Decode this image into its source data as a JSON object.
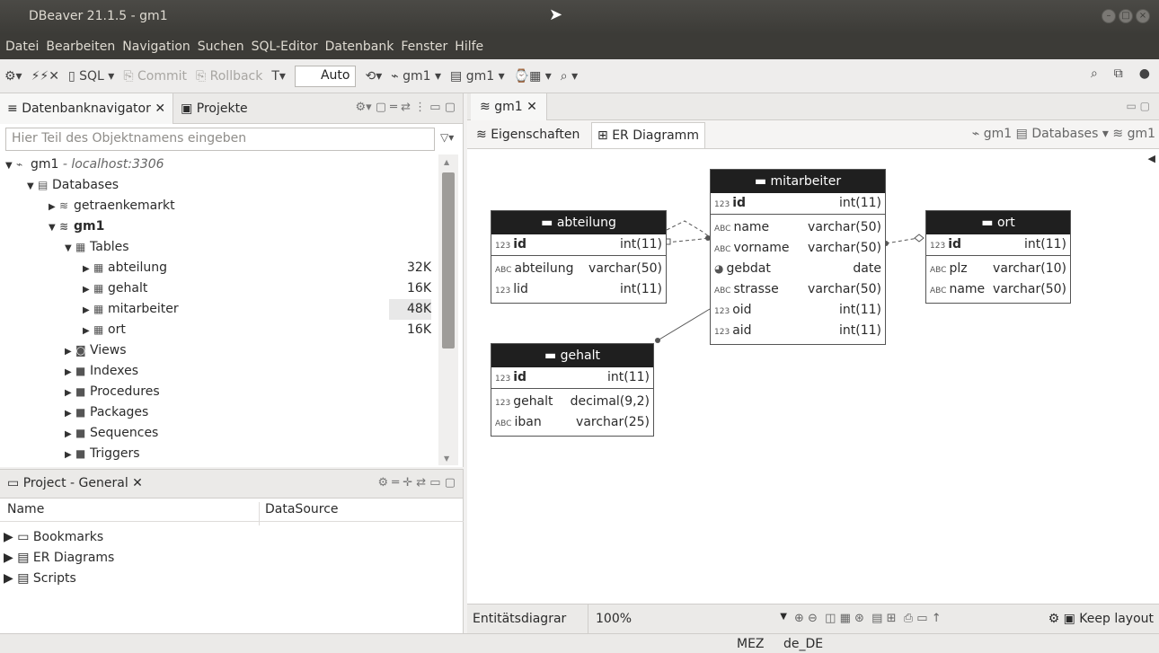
{
  "window": {
    "title": "DBeaver 21.1.5 - gm1"
  },
  "menu": [
    "Datei",
    "Bearbeiten",
    "Navigation",
    "Suchen",
    "SQL-Editor",
    "Datenbank",
    "Fenster",
    "Hilfe"
  ],
  "toolbar": {
    "sql_label": "SQL",
    "commit_label": "Commit",
    "rollback_label": "Rollback",
    "auto_label": "Auto",
    "datasource_label": "gm1",
    "schema_label": "gm1"
  },
  "navigator": {
    "tab_label": "Datenbanknavigator",
    "projects_tab_label": "Projekte",
    "filter_placeholder": "Hier Teil des Objektnamens eingeben",
    "connection": "gm1",
    "connection_host": "- localhost:3306",
    "databases_label": "Databases",
    "db1": "getraenkemarkt",
    "db2": "gm1",
    "tables_label": "Tables",
    "tables": [
      {
        "name": "abteilung",
        "size": "32K"
      },
      {
        "name": "gehalt",
        "size": "16K"
      },
      {
        "name": "mitarbeiter",
        "size": "48K"
      },
      {
        "name": "ort",
        "size": "16K"
      }
    ],
    "folders": [
      "Views",
      "Indexes",
      "Procedures",
      "Packages",
      "Sequences",
      "Triggers"
    ]
  },
  "project": {
    "title": "Project - General",
    "col_name": "Name",
    "col_datasource": "DataSource",
    "items": [
      "Bookmarks",
      "ER Diagrams",
      "Scripts"
    ]
  },
  "editor": {
    "tab_label": "gm1",
    "subtab_properties": "Eigenschaften",
    "subtab_er": "ER Diagramm",
    "crumb_ds": "gm1",
    "crumb_db": "Databases",
    "crumb_schema": "gm1"
  },
  "entities": {
    "mitarbeiter": {
      "title": "mitarbeiter",
      "pk": {
        "name": "id",
        "type": "int(11)"
      },
      "cols": [
        {
          "icon": "ABC",
          "name": "name",
          "type": "varchar(50)"
        },
        {
          "icon": "ABC",
          "name": "vorname",
          "type": "varchar(50)"
        },
        {
          "icon": "clock",
          "name": "gebdat",
          "type": "date"
        },
        {
          "icon": "ABC",
          "name": "strasse",
          "type": "varchar(50)"
        },
        {
          "icon": "123",
          "name": "oid",
          "type": "int(11)"
        },
        {
          "icon": "123",
          "name": "aid",
          "type": "int(11)"
        }
      ]
    },
    "abteilung": {
      "title": "abteilung",
      "pk": {
        "name": "id",
        "type": "int(11)"
      },
      "cols": [
        {
          "icon": "ABC",
          "name": "abteilung",
          "type": "varchar(50)"
        },
        {
          "icon": "123",
          "name": "lid",
          "type": "int(11)"
        }
      ]
    },
    "ort": {
      "title": "ort",
      "pk": {
        "name": "id",
        "type": "int(11)"
      },
      "cols": [
        {
          "icon": "ABC",
          "name": "plz",
          "type": "varchar(10)"
        },
        {
          "icon": "ABC",
          "name": "name",
          "type": "varchar(50)"
        }
      ]
    },
    "gehalt": {
      "title": "gehalt",
      "pk": {
        "name": "id",
        "type": "int(11)"
      },
      "cols": [
        {
          "icon": "123",
          "name": "gehalt",
          "type": "decimal(9,2)"
        },
        {
          "icon": "ABC",
          "name": "iban",
          "type": "varchar(25)"
        }
      ]
    }
  },
  "bottombar": {
    "diagram_label": "Entitätsdiagrar",
    "zoom": "100%",
    "keep_layout": "Keep layout"
  },
  "status": {
    "tz": "MEZ",
    "locale": "de_DE"
  }
}
